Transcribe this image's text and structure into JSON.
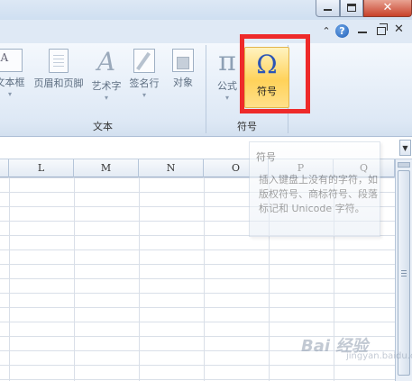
{
  "window": {
    "controls": [
      "minimize",
      "maximize",
      "close"
    ]
  },
  "ribbon_top": {
    "help_label": "?"
  },
  "ribbon": {
    "text_group": {
      "label": "文本",
      "buttons": [
        {
          "label": "文本框",
          "icon": "text-box-icon"
        },
        {
          "label": "页眉和页脚",
          "icon": "header-footer-icon"
        },
        {
          "label": "艺术字",
          "icon": "wordart-icon",
          "glyph": "A"
        },
        {
          "label": "签名行",
          "icon": "signature-line-icon"
        },
        {
          "label": "对象",
          "icon": "object-icon"
        }
      ]
    },
    "symbols_group": {
      "label": "符号",
      "equation": {
        "label": "公式",
        "glyph": "π"
      },
      "symbol": {
        "label": "符号",
        "glyph": "Ω"
      }
    }
  },
  "columns": [
    "L",
    "M",
    "N",
    "O",
    "P",
    "Q"
  ],
  "tooltip": {
    "title": "符号",
    "body": "插入键盘上没有的字符，如版权符号、商标符号、段落标记和 Unicode 字符。"
  },
  "textbox_glyph": "A",
  "watermark": {
    "text": "Bai 经验",
    "sub": "jingyan.baidu.com"
  },
  "colors": {
    "highlight": "#ee2a2a",
    "symbol_button": "#ffd25a",
    "ribbon_bg": "#dde8f5"
  }
}
